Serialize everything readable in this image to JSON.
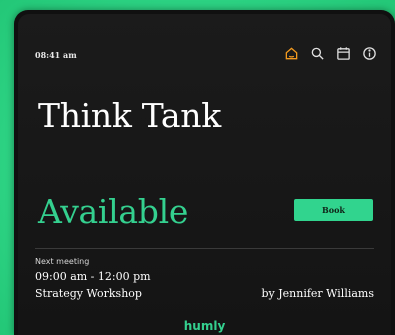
{
  "header": {
    "time": "08:41 am",
    "icons": [
      "home-icon",
      "search-icon",
      "calendar-icon",
      "info-icon"
    ],
    "active_icon_color": "#f39a1f",
    "icon_color": "#e0e0e0"
  },
  "room": {
    "name": "Think Tank",
    "status": "Available",
    "status_color": "#34d08f",
    "book_label": "Book"
  },
  "next_meeting": {
    "label": "Next meeting",
    "time_range": "09:00 am - 12:00 pm",
    "title": "Strategy Workshop",
    "organizer": "by Jennifer Williams"
  },
  "brand": {
    "logo": "humly",
    "color": "#34d08f"
  }
}
